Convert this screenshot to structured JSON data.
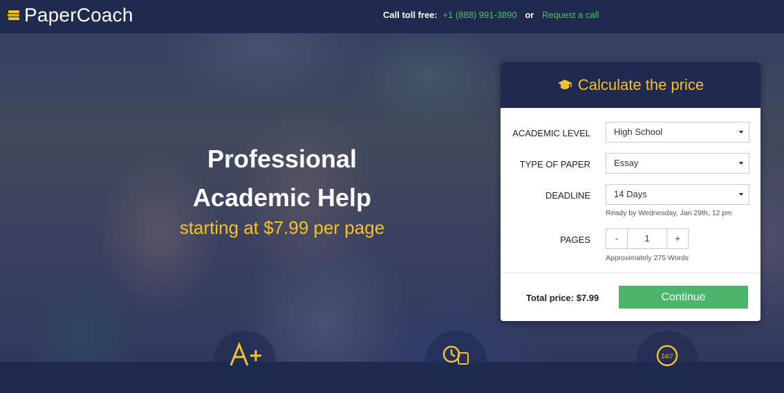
{
  "header": {
    "logo_text": "PaperCoach",
    "call_label": "Call toll free:",
    "phone": "+1 (888) 991-3890",
    "or_text": "or",
    "request_call": "Request a call"
  },
  "hero": {
    "headline_line1": "Professional",
    "headline_line2": "Academic Help",
    "subline": "starting at $7.99 per page"
  },
  "calculator": {
    "title": "Calculate the price",
    "academic_level": {
      "label": "ACADEMIC LEVEL",
      "value": "High School"
    },
    "type_of_paper": {
      "label": "TYPE OF PAPER",
      "value": "Essay"
    },
    "deadline": {
      "label": "DEADLINE",
      "value": "14 Days",
      "hint": "Ready by Wednesday, Jan 29th, 12 pm"
    },
    "pages": {
      "label": "PAGES",
      "minus": "-",
      "value": "1",
      "plus": "+",
      "hint": "Approximately 275 Words"
    },
    "total": "Total price: $7.99",
    "continue_label": "Continue"
  },
  "colors": {
    "navy": "#1f2a4e",
    "accent_yellow": "#f3c32b",
    "accent_green": "#4cb56b",
    "link_green": "#4fc36a"
  },
  "icons": {
    "logo": "stacked-books-icon",
    "calculator_title": "graduation-cap-icon",
    "features": [
      "a-plus-grade-icon",
      "clock-icon",
      "24-7-support-icon"
    ]
  }
}
